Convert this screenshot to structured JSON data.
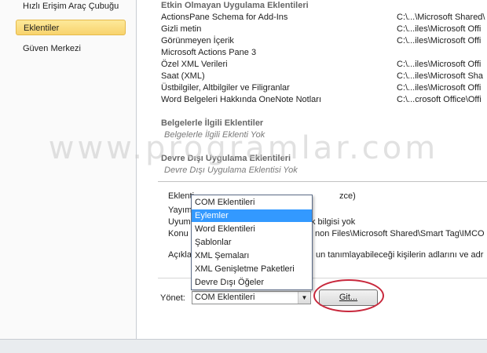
{
  "sidebar": {
    "items": [
      {
        "label": "Hızlı Erişim Araç Çubuğu"
      },
      {
        "label": "Eklentiler"
      },
      {
        "label": "Güven Merkezi"
      }
    ]
  },
  "list": {
    "inactive_header": "Etkin Olmayan Uygulama Eklentileri",
    "rows": [
      {
        "name": "ActionsPane Schema for Add-Ins",
        "location": "C:\\...\\Microsoft Shared\\"
      },
      {
        "name": "Gizli metin",
        "location": "C:\\...iles\\Microsoft Offi"
      },
      {
        "name": "Görünmeyen İçerik",
        "location": "C:\\...iles\\Microsoft Offi"
      },
      {
        "name": "Microsoft Actions Pane 3",
        "location": ""
      },
      {
        "name": "Özel XML Verileri",
        "location": "C:\\...iles\\Microsoft Offi"
      },
      {
        "name": "Saat (XML)",
        "location": "C:\\...iles\\Microsoft Sha"
      },
      {
        "name": "Üstbilgiler, Altbilgiler ve Filigranlar",
        "location": "C:\\...iles\\Microsoft Offi"
      },
      {
        "name": "Word Belgeleri Hakkında OneNote Notları",
        "location": "C:\\...crosoft Office\\Offi"
      }
    ],
    "doc_header": "Belgelerle İlgili Eklentiler",
    "doc_empty": "Belgelerle İlgili Eklenti Yok",
    "disabled_header": "Devre Dışı Uygulama Eklentileri",
    "disabled_empty": "Devre Dışı Uygulama Eklentisi Yok"
  },
  "details": {
    "line1": "Eklenti",
    "line1_tail": "zce)",
    "line2": "Yayım",
    "line3": "Uyum",
    "line3_tail": "k bilgisi yok",
    "line4": "Konu",
    "line4_tail": "non Files\\Microsoft Shared\\Smart Tag\\IMCO",
    "line5": "Açıkla",
    "line5_tail": "un tanımlayabileceği kişilerin adlarını ve adr"
  },
  "dropdown": {
    "options": [
      {
        "label": "COM Eklentileri"
      },
      {
        "label": "Eylemler"
      },
      {
        "label": "Word Eklentileri"
      },
      {
        "label": "Şablonlar"
      },
      {
        "label": "XML Şemaları"
      },
      {
        "label": "XML Genişletme Paketleri"
      },
      {
        "label": "Devre Dışı Öğeler"
      }
    ],
    "selected_option": "Eylemler"
  },
  "manage": {
    "label": "Yönet:",
    "value": "COM Eklentileri",
    "go_button": "Git..."
  },
  "watermark": "www.programlar.com",
  "colors": {
    "selection": "#3399ff",
    "active_sidebar": "#f8d36d",
    "highlight_circle": "#c8283c"
  }
}
